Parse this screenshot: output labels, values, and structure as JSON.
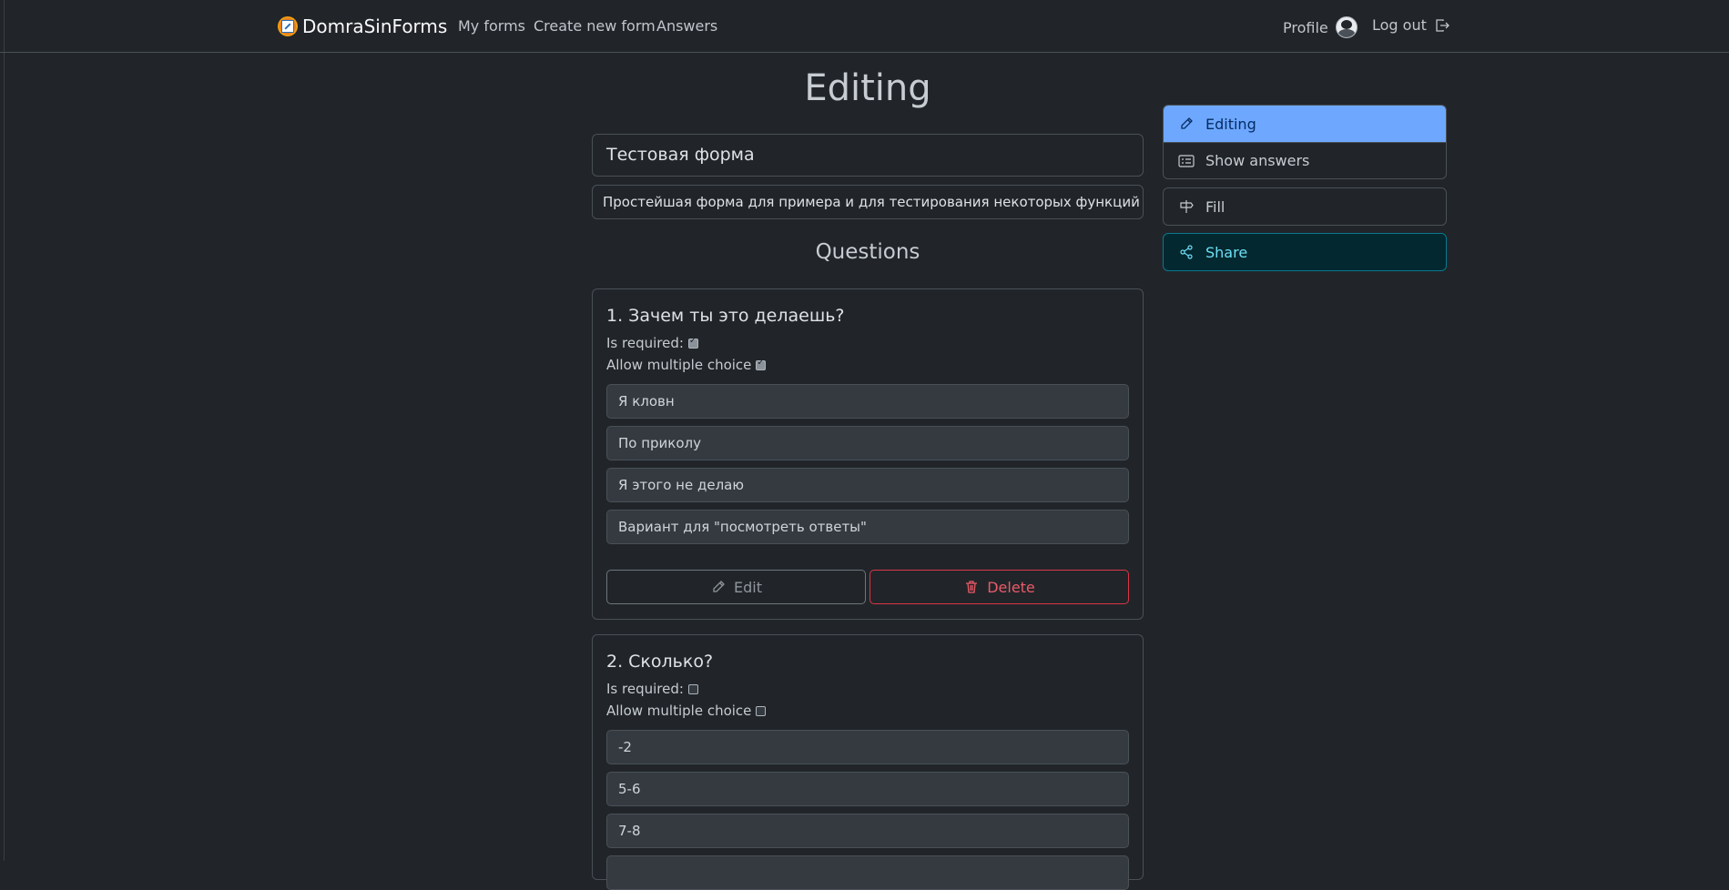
{
  "navbar": {
    "brand": "DomraSinForms",
    "links": [
      "My forms",
      "Create new form",
      "Answers"
    ],
    "profile": "Profile",
    "logout": "Log out"
  },
  "page": {
    "title": "Editing",
    "form_title": "Тестовая форма",
    "form_description": "Простейшая форма для примера и для тестирования некоторых функций ++",
    "questions_header": "Questions"
  },
  "questions": [
    {
      "title": "1. Зачем ты это делаешь?",
      "required_label": "Is required:",
      "required": true,
      "multiple_label": "Allow multiple choice",
      "multiple": true,
      "options": [
        "Я кловн",
        "По приколу",
        "Я этого не делаю",
        "Вариант для \"посмотреть ответы\""
      ],
      "edit_label": "Edit",
      "delete_label": "Delete"
    },
    {
      "title": "2. Сколько?",
      "required_label": "Is required:",
      "required": false,
      "multiple_label": "Allow multiple choice",
      "multiple": false,
      "options": [
        "-2",
        "5-6",
        "7-8",
        ""
      ]
    }
  ],
  "sidebar": {
    "editing": "Editing",
    "show_answers": "Show answers",
    "fill": "Fill",
    "share": "Share"
  },
  "colors": {
    "background": "#212529",
    "active": "#6ea8fe",
    "share": "#6edff6",
    "danger": "#dc3545"
  },
  "icons": [
    "pencil-icon",
    "list-card-icon",
    "signpost-icon",
    "share-icon",
    "trash-icon",
    "logout-icon"
  ]
}
